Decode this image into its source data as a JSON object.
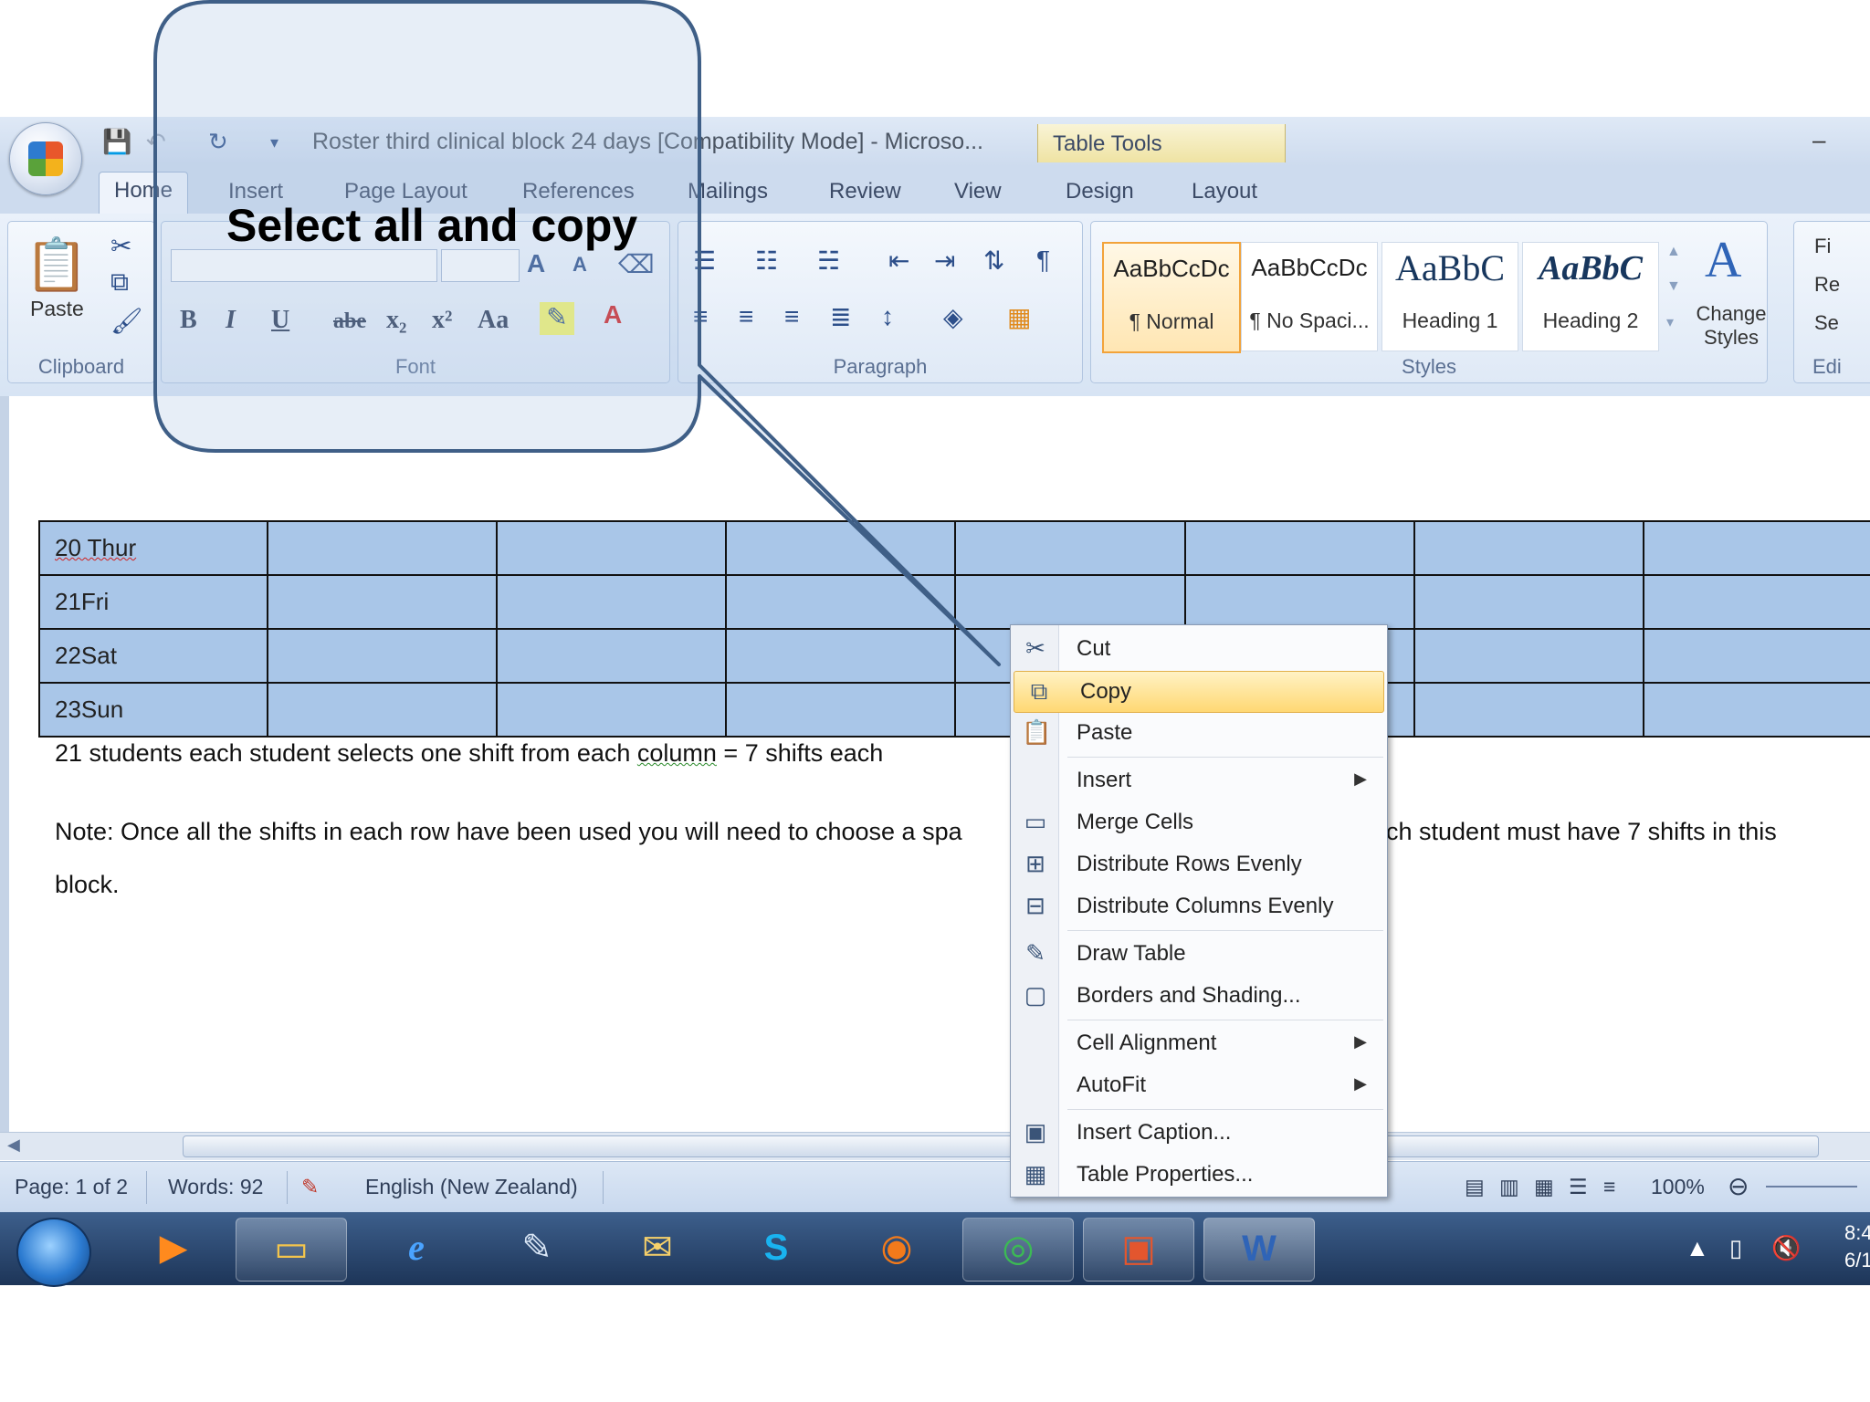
{
  "window": {
    "title": "Roster third clinical block 24 days [Compatibility Mode] - Microso...",
    "context_tab": "Table Tools",
    "minimize_glyph": "–"
  },
  "tabs": [
    "Home",
    "Insert",
    "Page Layout",
    "References",
    "Mailings",
    "Review",
    "View",
    "Design",
    "Layout"
  ],
  "ribbon": {
    "clipboard": {
      "paste_label": "Paste",
      "group_label": "Clipboard"
    },
    "font": {
      "group_label": "Font",
      "buttons": [
        "B",
        "I",
        "U",
        "abe",
        "x₂",
        "x²",
        "Aa"
      ]
    },
    "paragraph": {
      "group_label": "Paragraph"
    },
    "styles": {
      "group_label": "Styles",
      "tiles": [
        {
          "sample": "AaBbCcDc",
          "name": "¶ Normal"
        },
        {
          "sample": "AaBbCcDc",
          "name": "¶ No Spaci..."
        },
        {
          "sample": "AaBbC",
          "name": "Heading 1"
        },
        {
          "sample": "AaBbC",
          "name": "Heading 2"
        }
      ],
      "change_styles": "Change Styles"
    },
    "editing": {
      "group_label": "Edi",
      "find": "Fi",
      "replace": "Re",
      "select": "Se"
    }
  },
  "callout": {
    "text": "Select all and copy"
  },
  "document": {
    "rows": [
      "20 Thur",
      "21Fri",
      "22Sat",
      "23Sun"
    ],
    "line1_a": "21 students each student selects one shift from each ",
    "line1_b": "column",
    "line1_c": " = 7 shifts each",
    "line2_a": "Note: Once all the shifts in each row have been used you will need to choose a spa",
    "line2_b": "ch student must have 7 shifts in this",
    "line3": "block."
  },
  "context_menu": {
    "items": [
      {
        "label": "Cut",
        "icon": "scissors-icon",
        "glyph": "✂"
      },
      {
        "label": "Copy",
        "icon": "copy-icon",
        "glyph": "⧉",
        "highlighted": true
      },
      {
        "label": "Paste",
        "icon": "paste-icon",
        "glyph": "📋"
      },
      {
        "label": "Insert",
        "submenu": true
      },
      {
        "label": "Merge Cells",
        "icon": "merge-cells-icon",
        "glyph": "▭"
      },
      {
        "label": "Distribute Rows Evenly",
        "icon": "distribute-rows-icon",
        "glyph": "⊞"
      },
      {
        "label": "Distribute Columns Evenly",
        "icon": "distribute-columns-icon",
        "glyph": "⊟"
      },
      {
        "label": "Draw Table",
        "icon": "draw-table-icon",
        "glyph": "✎"
      },
      {
        "label": "Borders and Shading...",
        "icon": "borders-icon",
        "glyph": "▢"
      },
      {
        "label": "Cell Alignment",
        "submenu": true
      },
      {
        "label": "AutoFit",
        "submenu": true
      },
      {
        "label": "Insert Caption...",
        "icon": "caption-icon",
        "glyph": "▣"
      },
      {
        "label": "Table Properties...",
        "icon": "table-properties-icon",
        "glyph": "▦"
      }
    ]
  },
  "statusbar": {
    "page": "Page: 1 of 2",
    "words": "Words: 92",
    "language": "English (New Zealand)",
    "zoom": "100%"
  },
  "tray": {
    "time": "8:4",
    "date": "6/1"
  }
}
